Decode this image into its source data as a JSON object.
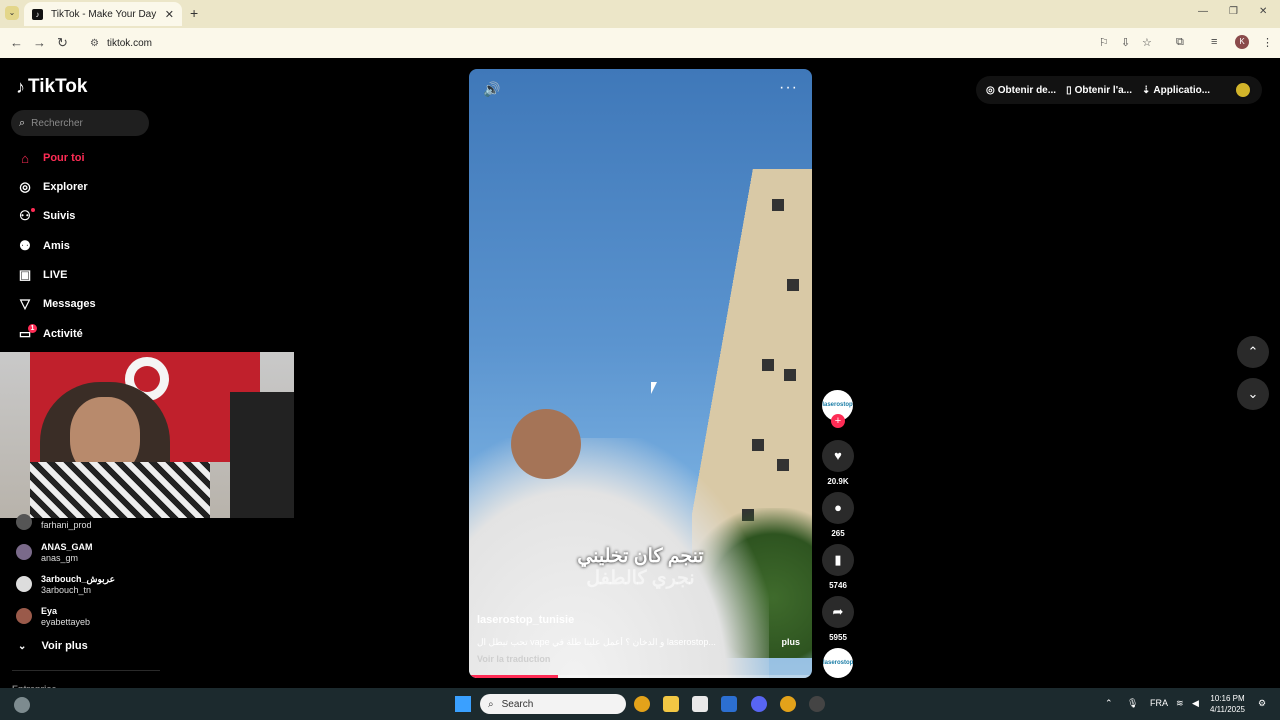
{
  "browser": {
    "tab_title": "TikTok - Make Your Day",
    "tab_icon": "tiktok-icon",
    "url": "tiktok.com"
  },
  "sidebar": {
    "logo_text": "TikTok",
    "search_placeholder": "Rechercher",
    "nav": [
      {
        "label": "Pour toi",
        "icon": "home-icon"
      },
      {
        "label": "Explorer",
        "icon": "compass-icon"
      },
      {
        "label": "Suivis",
        "icon": "following-icon"
      },
      {
        "label": "Amis",
        "icon": "friends-icon"
      },
      {
        "label": "LIVE",
        "icon": "live-icon"
      },
      {
        "label": "Messages",
        "icon": "messages-icon"
      },
      {
        "label": "Activité",
        "icon": "activity-icon"
      }
    ],
    "activity_badge": "1",
    "following": [
      {
        "name": "",
        "handle": "farhani_prod"
      },
      {
        "name": "ANAS_GAM",
        "handle": "anas_gm"
      },
      {
        "name": "3arbouch_عربوش",
        "handle": "3arbouch_tn"
      },
      {
        "name": "Eya",
        "handle": "eyabettayeb"
      }
    ],
    "see_more": "Voir plus",
    "company": "Entreprise"
  },
  "video": {
    "subtitle_line1": "تنجم كان تخليني",
    "subtitle_line2": "نجري كالطفل",
    "author": "laserostop_tunisie",
    "caption": "تحب تبطل ال vape و الدخان ؟ أعمل علينا طلة في laserostop...",
    "more_label": "plus",
    "translate_label": "Voir la traduction",
    "progress": 0.26
  },
  "actions": {
    "avatar_text": "laserostop",
    "likes": "20.9K",
    "comments": "265",
    "saves": "5746",
    "shares": "5955"
  },
  "top_actions": [
    {
      "label": "Obtenir de...",
      "icon": "coin-icon"
    },
    {
      "label": "Obtenir l'a...",
      "icon": "phone-icon"
    },
    {
      "label": "Applicatio...",
      "icon": "download-icon"
    }
  ],
  "taskbar": {
    "search_label": "Search",
    "language": "FRA",
    "time": "10:16 PM",
    "date": "4/11/2025"
  }
}
